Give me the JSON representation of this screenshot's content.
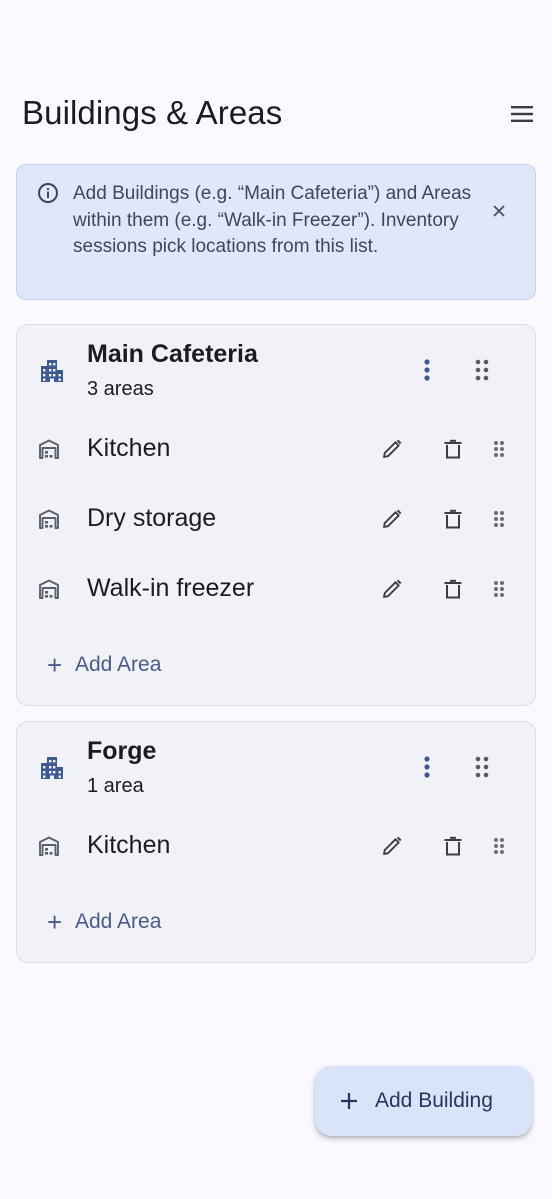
{
  "header": {
    "title": "Buildings & Areas"
  },
  "banner": {
    "text": "Add Buildings (e.g. “Main Cafeteria”) and Areas within them (e.g. “Walk-in Freezer”). Inventory sessions pick locations from this list."
  },
  "buildings": [
    {
      "name": "Main Cafeteria",
      "count": "3 areas",
      "areas": [
        "Kitchen",
        "Dry storage",
        "Walk-in freezer"
      ],
      "add_area_label": "Add Area"
    },
    {
      "name": "Forge",
      "count": "1 area",
      "areas": [
        "Kitchen"
      ],
      "add_area_label": "Add Area"
    }
  ],
  "fab": {
    "label": "Add Building"
  },
  "colors": {
    "accent": "#475c8a",
    "building_icon": "#3e5a93",
    "fab_bg": "#d9e3fa",
    "banner_bg": "#dfe7fb"
  },
  "icons": {
    "menu": "hamburger-icon",
    "info": "info-icon",
    "close": "close-icon",
    "building": "building-icon",
    "area": "warehouse-icon",
    "edit": "pencil-icon",
    "delete": "trash-icon",
    "drag": "drag-handle-icon",
    "more": "more-vert-icon"
  }
}
